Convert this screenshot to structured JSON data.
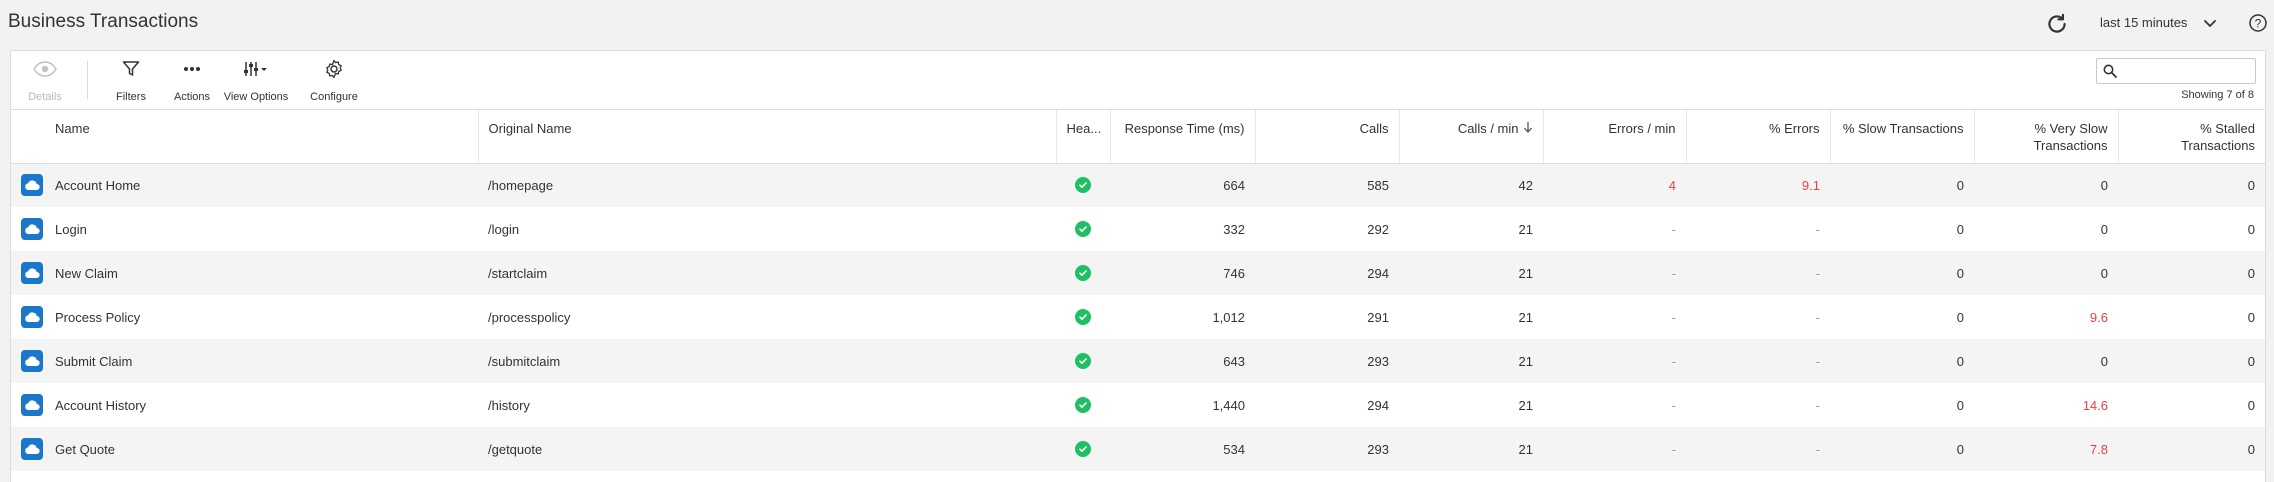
{
  "header": {
    "title": "Business Transactions",
    "time_range": "last 15 minutes"
  },
  "toolbar": {
    "details": "Details",
    "filters": "Filters",
    "actions": "Actions",
    "view_options": "View Options",
    "configure": "Configure",
    "search_placeholder": "",
    "showing": "Showing 7 of 8"
  },
  "table": {
    "columns": {
      "name": "Name",
      "original_name": "Original Name",
      "health": "Hea...",
      "response_time": "Response Time (ms)",
      "calls": "Calls",
      "calls_per_min": "Calls / min",
      "errors_per_min": "Errors / min",
      "pct_errors": "% Errors",
      "pct_slow": "% Slow Transactions",
      "pct_very_slow_1": "% Very Slow",
      "pct_very_slow_2": "Transactions",
      "pct_stalled_1": "% Stalled",
      "pct_stalled_2": "Transactions"
    },
    "rows": [
      {
        "name": "Account Home",
        "original_name": "/homepage",
        "response_time": "664",
        "calls": "585",
        "calls_per_min": "42",
        "errors_per_min": "4",
        "pct_errors": "9.1",
        "pct_slow": "0",
        "pct_very_slow": "0",
        "pct_stalled": "0"
      },
      {
        "name": "Login",
        "original_name": "/login",
        "response_time": "332",
        "calls": "292",
        "calls_per_min": "21",
        "errors_per_min": "-",
        "pct_errors": "-",
        "pct_slow": "0",
        "pct_very_slow": "0",
        "pct_stalled": "0"
      },
      {
        "name": "New Claim",
        "original_name": "/startclaim",
        "response_time": "746",
        "calls": "294",
        "calls_per_min": "21",
        "errors_per_min": "-",
        "pct_errors": "-",
        "pct_slow": "0",
        "pct_very_slow": "0",
        "pct_stalled": "0"
      },
      {
        "name": "Process Policy",
        "original_name": "/processpolicy",
        "response_time": "1,012",
        "calls": "291",
        "calls_per_min": "21",
        "errors_per_min": "-",
        "pct_errors": "-",
        "pct_slow": "0",
        "pct_very_slow": "9.6",
        "pct_stalled": "0"
      },
      {
        "name": "Submit Claim",
        "original_name": "/submitclaim",
        "response_time": "643",
        "calls": "293",
        "calls_per_min": "21",
        "errors_per_min": "-",
        "pct_errors": "-",
        "pct_slow": "0",
        "pct_very_slow": "0",
        "pct_stalled": "0"
      },
      {
        "name": "Account History",
        "original_name": "/history",
        "response_time": "1,440",
        "calls": "294",
        "calls_per_min": "21",
        "errors_per_min": "-",
        "pct_errors": "-",
        "pct_slow": "0",
        "pct_very_slow": "14.6",
        "pct_stalled": "0"
      },
      {
        "name": "Get Quote",
        "original_name": "/getquote",
        "response_time": "534",
        "calls": "293",
        "calls_per_min": "21",
        "errors_per_min": "-",
        "pct_errors": "-",
        "pct_slow": "0",
        "pct_very_slow": "7.8",
        "pct_stalled": "0"
      }
    ]
  },
  "colors": {
    "accent_blue": "#1b77c9",
    "health_green": "#1fbf64",
    "alert_red": "#e04545"
  }
}
